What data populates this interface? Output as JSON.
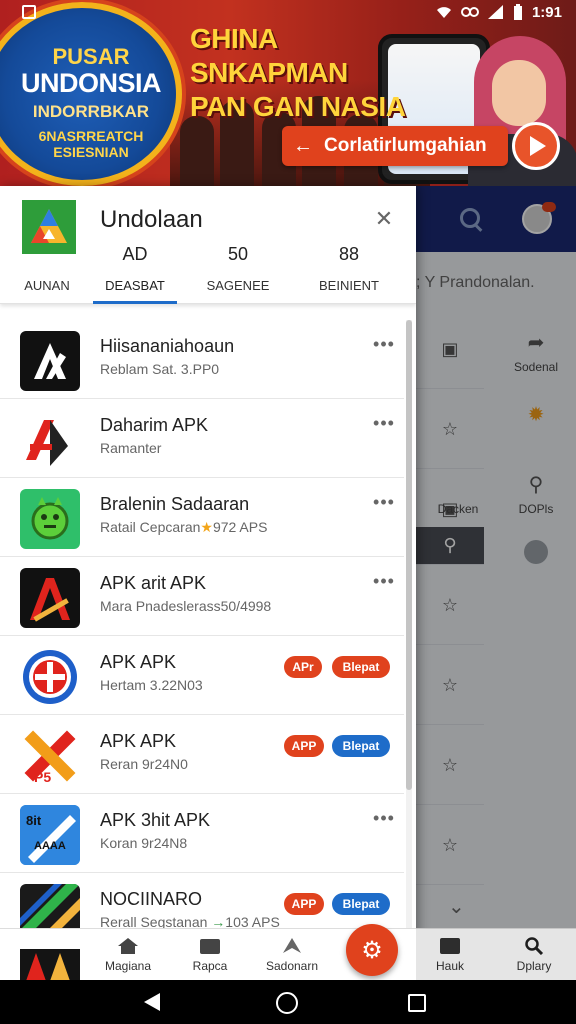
{
  "status_bar": {
    "time": "1:91"
  },
  "banner": {
    "badge": [
      "PUSAR",
      "UNDONSIA",
      "INDORRBKAR",
      "6NASRREATCH ESIESNIAN"
    ],
    "headline": [
      "GHINA SNKAPMAN",
      "PAN GAN NASIA"
    ],
    "cta_label": "Corlatirlumgahian"
  },
  "drawer": {
    "title": "Undolaan",
    "stats": [
      {
        "value": "",
        "label": "AUNAN"
      },
      {
        "value": "AD",
        "label": "DEASBAT"
      },
      {
        "value": "50",
        "label": "SAGENEE"
      },
      {
        "value": "88",
        "label": "BEINIENT"
      }
    ],
    "apps": [
      {
        "name": "Hiisananiahoaun",
        "meta": "Reblam Sat. 3.PP0",
        "action": "more"
      },
      {
        "name": "Daharim APK",
        "meta": "Ramanter",
        "action": "more"
      },
      {
        "name": "Bralenin Sadaaran",
        "meta": "Ratail Cepcaran",
        "meta_extra": "972 APS",
        "action": "more"
      },
      {
        "name": "APK arit APK",
        "meta": "Mara Pnadeslerass50/4998",
        "action": "more"
      },
      {
        "name": "APK APK",
        "meta": "Hertam 3.22N03",
        "action": "pills",
        "pill1": "APr",
        "pill2": "Blepat"
      },
      {
        "name": "APK APK",
        "meta": "Reran 9r24N0",
        "action": "pills",
        "pill1": "APP",
        "pill2": "Blepat"
      },
      {
        "name": "APK 3hit APK",
        "meta": "Koran 9r24N8",
        "action": "more"
      },
      {
        "name": "NOCIINARO",
        "meta": "Rerall Segstanan",
        "meta_extra": "103 APS",
        "action": "pills",
        "pill1": "APP",
        "pill2": "Blepat"
      }
    ]
  },
  "background_app": {
    "search_text": "; Y Prandonalan.",
    "side_labels": [
      "Sodenal",
      "Dacken",
      "DOPls"
    ]
  },
  "bottom_nav": {
    "items": [
      "Magiana",
      "Rapca",
      "Sadonarn",
      "Hauk",
      "Dplary"
    ]
  },
  "icons": {
    "drawer_logo": "drive-triangle-icon",
    "close": "close-icon",
    "more": "more-horizontal-icon",
    "fab": "gear-icon"
  },
  "colors": {
    "accent_red": "#e0421d",
    "accent_blue": "#1e6cc9",
    "header_navy": "#1b2a73"
  }
}
